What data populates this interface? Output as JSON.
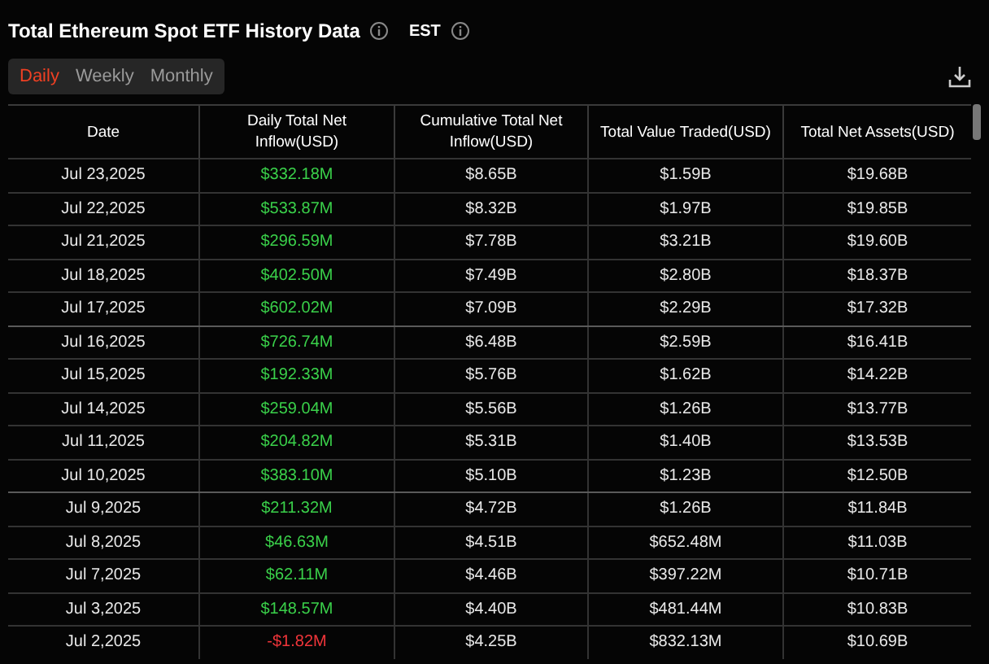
{
  "title": "Total Ethereum Spot ETF History Data",
  "timezone": "EST",
  "tabs": [
    {
      "label": "Daily",
      "selected": true
    },
    {
      "label": "Weekly",
      "selected": false
    },
    {
      "label": "Monthly",
      "selected": false
    }
  ],
  "table": {
    "columns": [
      "Date",
      "Daily Total Net Inflow(USD)",
      "Cumulative Total Net Inflow(USD)",
      "Total Value Traded(USD)",
      "Total Net Assets(USD)"
    ],
    "rows": [
      {
        "date": "Jul 23,2025",
        "inflow": "$332.18M",
        "positive": true,
        "cumulative": "$8.65B",
        "traded": "$1.59B",
        "assets": "$19.68B"
      },
      {
        "date": "Jul 22,2025",
        "inflow": "$533.87M",
        "positive": true,
        "cumulative": "$8.32B",
        "traded": "$1.97B",
        "assets": "$19.85B"
      },
      {
        "date": "Jul 21,2025",
        "inflow": "$296.59M",
        "positive": true,
        "cumulative": "$7.78B",
        "traded": "$3.21B",
        "assets": "$19.60B"
      },
      {
        "date": "Jul 18,2025",
        "inflow": "$402.50M",
        "positive": true,
        "cumulative": "$7.49B",
        "traded": "$2.80B",
        "assets": "$18.37B"
      },
      {
        "date": "Jul 17,2025",
        "inflow": "$602.02M",
        "positive": true,
        "cumulative": "$7.09B",
        "traded": "$2.29B",
        "assets": "$17.32B"
      },
      {
        "date": "Jul 16,2025",
        "inflow": "$726.74M",
        "positive": true,
        "cumulative": "$6.48B",
        "traded": "$2.59B",
        "assets": "$16.41B"
      },
      {
        "date": "Jul 15,2025",
        "inflow": "$192.33M",
        "positive": true,
        "cumulative": "$5.76B",
        "traded": "$1.62B",
        "assets": "$14.22B"
      },
      {
        "date": "Jul 14,2025",
        "inflow": "$259.04M",
        "positive": true,
        "cumulative": "$5.56B",
        "traded": "$1.26B",
        "assets": "$13.77B"
      },
      {
        "date": "Jul 11,2025",
        "inflow": "$204.82M",
        "positive": true,
        "cumulative": "$5.31B",
        "traded": "$1.40B",
        "assets": "$13.53B"
      },
      {
        "date": "Jul 10,2025",
        "inflow": "$383.10M",
        "positive": true,
        "cumulative": "$5.10B",
        "traded": "$1.23B",
        "assets": "$12.50B"
      },
      {
        "date": "Jul 9,2025",
        "inflow": "$211.32M",
        "positive": true,
        "cumulative": "$4.72B",
        "traded": "$1.26B",
        "assets": "$11.84B"
      },
      {
        "date": "Jul 8,2025",
        "inflow": "$46.63M",
        "positive": true,
        "cumulative": "$4.51B",
        "traded": "$652.48M",
        "assets": "$11.03B"
      },
      {
        "date": "Jul 7,2025",
        "inflow": "$62.11M",
        "positive": true,
        "cumulative": "$4.46B",
        "traded": "$397.22M",
        "assets": "$10.71B"
      },
      {
        "date": "Jul 3,2025",
        "inflow": "$148.57M",
        "positive": true,
        "cumulative": "$4.40B",
        "traded": "$481.44M",
        "assets": "$10.83B"
      },
      {
        "date": "Jul 2,2025",
        "inflow": "-$1.82M",
        "positive": false,
        "cumulative": "$4.25B",
        "traded": "$832.13M",
        "assets": "$10.69B"
      }
    ]
  }
}
